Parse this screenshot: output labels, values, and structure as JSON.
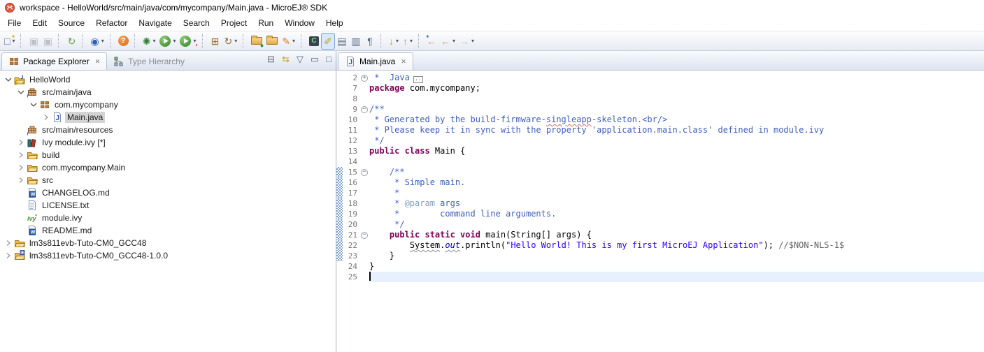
{
  "window": {
    "title": "workspace - HelloWorld/src/main/java/com/mycompany/Main.java - MicroEJ® SDK"
  },
  "menubar": {
    "items": [
      "File",
      "Edit",
      "Source",
      "Refactor",
      "Navigate",
      "Search",
      "Project",
      "Run",
      "Window",
      "Help"
    ]
  },
  "ui": {
    "close_glyph": "✕",
    "dropdown_glyph": "▾"
  },
  "toolbar": {
    "items": [
      {
        "name": "new-wizard-button",
        "glyph": "□",
        "cls": "c-slate",
        "overlay": "✶",
        "overlayCls": "ov-gold",
        "dd": true
      },
      {
        "sep": true
      },
      {
        "name": "save-button",
        "glyph": "▣",
        "cls": "c-slate",
        "disabled": true
      },
      {
        "name": "save-all-button",
        "glyph": "▣",
        "cls": "c-slate",
        "disabled": true
      },
      {
        "sep": true
      },
      {
        "name": "sync-ivy-button",
        "glyph": "↻",
        "cls": "c-green"
      },
      {
        "sep": true
      },
      {
        "name": "microej-launch-button",
        "glyph": "◉",
        "cls": "c-blue",
        "dd": true
      },
      {
        "sep": true
      },
      {
        "name": "support-help-button",
        "glyph": "?",
        "cls": "badge-orange"
      },
      {
        "sep": true
      },
      {
        "name": "debug-button",
        "glyph": "✺",
        "cls": "c-dkgreen",
        "dd": true
      },
      {
        "name": "run-button",
        "glyph": "▶",
        "cls": "badge-green",
        "dd": true
      },
      {
        "name": "external-tools-button",
        "glyph": "▶",
        "cls": "badge-green",
        "overlay": "▪",
        "overlayCls": "ov-red",
        "dd": true
      },
      {
        "sep": true
      },
      {
        "name": "build-all-button",
        "glyph": "⊞",
        "cls": "c-brown"
      },
      {
        "name": "refresh-build-button",
        "glyph": "↻",
        "cls": "c-brown",
        "dd": true
      },
      {
        "sep": true
      },
      {
        "name": "import-folder-button",
        "glyph": "",
        "cls": "folder",
        "overlay": "●",
        "overlayCls": "ov-green-sm"
      },
      {
        "name": "open-folder-button",
        "glyph": "",
        "cls": "folder"
      },
      {
        "name": "marker-pen-button",
        "glyph": "✎",
        "cls": "c-orange",
        "dd": true
      },
      {
        "sep": true
      },
      {
        "name": "java-element-button",
        "glyph": "C",
        "cls": "badge-dark"
      },
      {
        "name": "mark-occurrences-toggle",
        "glyph": "✐",
        "cls": "c-gold",
        "active": true
      },
      {
        "name": "link-with-editor-button",
        "glyph": "▤",
        "cls": "c-slate"
      },
      {
        "name": "block-selection-button",
        "glyph": "▥",
        "cls": "c-slate"
      },
      {
        "name": "show-whitespace-button",
        "glyph": "¶",
        "cls": "c-slate"
      },
      {
        "sep": true
      },
      {
        "name": "next-annotation-button",
        "glyph": "↓",
        "cls": "c-gold-dk",
        "dd": true
      },
      {
        "name": "prev-annotation-button",
        "glyph": "↑",
        "cls": "c-gold-dk",
        "dd": true
      },
      {
        "sep": true
      },
      {
        "name": "last-edit-location-button",
        "glyph": "←",
        "cls": "c-gold-dk",
        "overlay": "✶",
        "overlayCls": "ov-blue"
      },
      {
        "name": "back-button",
        "glyph": "←",
        "cls": "c-gold-dk",
        "dd": true
      },
      {
        "name": "forward-button",
        "glyph": "→",
        "cls": "c-gray",
        "disabled": true,
        "dd": true
      }
    ]
  },
  "explorer": {
    "tab_label": "Package Explorer",
    "tab2_label": "Type Hierarchy",
    "toolbar": [
      {
        "name": "collapse-all-button",
        "glyph": "⊟"
      },
      {
        "name": "link-editor-toggle",
        "glyph": "⇆",
        "cls": "gold"
      },
      {
        "name": "view-menu-button",
        "glyph": "▽"
      },
      {
        "name": "minimize-view-button",
        "glyph": "▭"
      },
      {
        "name": "maximize-view-button",
        "glyph": "□"
      }
    ],
    "tree": [
      {
        "label": "HelloWorld",
        "level": 0,
        "arrow": "exp",
        "icon": "java-project"
      },
      {
        "label": "src/main/java",
        "level": 1,
        "arrow": "exp",
        "icon": "source-folder"
      },
      {
        "label": "com.mycompany",
        "level": 2,
        "arrow": "exp",
        "icon": "package"
      },
      {
        "label": "Main.java",
        "level": 3,
        "arrow": "col",
        "icon": "java-file",
        "selected": true
      },
      {
        "label": "src/main/resources",
        "level": 1,
        "arrow": null,
        "icon": "source-folder"
      },
      {
        "label": "Ivy module.ivy [*]",
        "level": 1,
        "arrow": "col",
        "icon": "ivy-lib"
      },
      {
        "label": "build",
        "level": 1,
        "arrow": "col",
        "icon": "folder"
      },
      {
        "label": "com.mycompany.Main",
        "level": 1,
        "arrow": "col",
        "icon": "folder"
      },
      {
        "label": "src",
        "level": 1,
        "arrow": "col",
        "icon": "folder"
      },
      {
        "label": "CHANGELOG.md",
        "level": 1,
        "arrow": null,
        "icon": "md-file"
      },
      {
        "label": "LICENSE.txt",
        "level": 1,
        "arrow": null,
        "icon": "txt-file"
      },
      {
        "label": "module.ivy",
        "level": 1,
        "arrow": null,
        "icon": "ivy-file"
      },
      {
        "label": "README.md",
        "level": 1,
        "arrow": null,
        "icon": "md-file"
      },
      {
        "label": "lm3s811evb-Tuto-CM0_GCC48",
        "level": 0,
        "arrow": "col",
        "icon": "folder"
      },
      {
        "label": "lm3s811evb-Tuto-CM0_GCC48-1.0.0",
        "level": 0,
        "arrow": "col",
        "icon": "folder-pkg"
      }
    ]
  },
  "editor": {
    "tab_label": "Main.java",
    "lines": [
      {
        "n": "2",
        "fold": "plus",
        "foldbox": true,
        "segs": [
          [
            "doc",
            " *  Java"
          ]
        ]
      },
      {
        "n": "7",
        "segs": [
          [
            "kw",
            "package"
          ],
          [
            "pl",
            " com.mycompany;"
          ]
        ]
      },
      {
        "n": "8",
        "segs": []
      },
      {
        "n": "9",
        "fold": "minus",
        "segs": [
          [
            "doc",
            "/**"
          ]
        ]
      },
      {
        "n": "10",
        "segs": [
          [
            "doc",
            " * Generated by the build-firmware-"
          ],
          [
            "doc spell",
            "singleapp"
          ],
          [
            "doc",
            "-skeleton.<br/>"
          ]
        ]
      },
      {
        "n": "11",
        "segs": [
          [
            "doc",
            " * Please keep it in sync with the property 'application.main.class' defined in module.ivy"
          ]
        ]
      },
      {
        "n": "12",
        "segs": [
          [
            "doc",
            " */"
          ]
        ]
      },
      {
        "n": "13",
        "segs": [
          [
            "kw",
            "public class"
          ],
          [
            "pl",
            " Main {"
          ]
        ]
      },
      {
        "n": "14",
        "segs": []
      },
      {
        "n": "15",
        "fold": "minus",
        "range": true,
        "segs": [
          [
            "doc",
            "    /**"
          ]
        ]
      },
      {
        "n": "16",
        "range": true,
        "segs": [
          [
            "doc",
            "     * Simple main."
          ]
        ]
      },
      {
        "n": "17",
        "range": true,
        "segs": [
          [
            "doc",
            "     *"
          ]
        ]
      },
      {
        "n": "18",
        "range": true,
        "segs": [
          [
            "doc",
            "     * "
          ],
          [
            "tag",
            "@param"
          ],
          [
            "doc",
            " args"
          ]
        ]
      },
      {
        "n": "19",
        "range": true,
        "segs": [
          [
            "doc",
            "     *        command line arguments."
          ]
        ]
      },
      {
        "n": "20",
        "range": true,
        "segs": [
          [
            "doc",
            "     */"
          ]
        ]
      },
      {
        "n": "21",
        "fold": "minus",
        "range": true,
        "segs": [
          [
            "pl",
            "    "
          ],
          [
            "kw",
            "public static void"
          ],
          [
            "pl",
            " main(String[] args) {"
          ]
        ]
      },
      {
        "n": "22",
        "range": true,
        "segs": [
          [
            "pl",
            "        "
          ],
          [
            "pl warn",
            "System"
          ],
          [
            "pl",
            "."
          ],
          [
            "sf warn",
            "out"
          ],
          [
            "pl",
            ".println("
          ],
          [
            "str",
            "\"Hello World! This is my first MicroEJ Application\""
          ],
          [
            "pl",
            "); "
          ],
          [
            "nls",
            "//$NON-NLS-1$"
          ]
        ]
      },
      {
        "n": "23",
        "range": true,
        "segs": [
          [
            "pl",
            "    }"
          ]
        ]
      },
      {
        "n": "24",
        "segs": [
          [
            "pl",
            "}"
          ]
        ]
      },
      {
        "n": "25",
        "current": true,
        "caret": true,
        "segs": []
      }
    ]
  },
  "colors": {
    "keyword": "#7f0055",
    "javadoc": "#3f5fbf",
    "javadoc_tag": "#7f9fbf",
    "string": "#2a00ff",
    "static_field": "#0000c0",
    "nls_tag": "#646464",
    "current_line_bg": "#e6f1fd",
    "selection_bg": "#d4d4d4",
    "range_indicator": "#7ba3d4"
  }
}
